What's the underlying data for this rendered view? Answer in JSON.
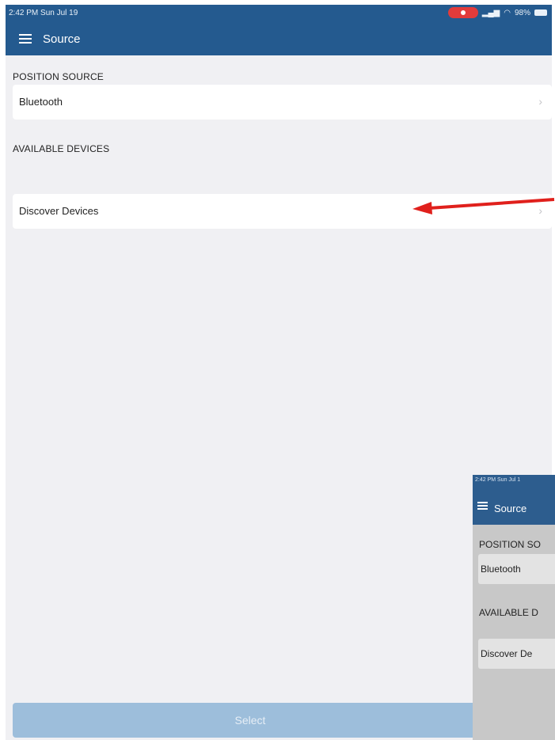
{
  "status_bar": {
    "time": "2:42 PM  Sun Jul 19",
    "battery": "98%"
  },
  "nav": {
    "title": "Source"
  },
  "position_source": {
    "header": "POSITION SOURCE",
    "value": "Bluetooth"
  },
  "available_devices": {
    "header": "AVAILABLE DEVICES",
    "discover_label": "Discover Devices"
  },
  "footer": {
    "select_label": "Select"
  },
  "thumbnail": {
    "time": "2:42 PM  Sun Jul 1",
    "title": "Source",
    "position_header": "POSITION SO",
    "position_value": "Bluetooth",
    "devices_header": "AVAILABLE D",
    "discover_label": "Discover De"
  },
  "colors": {
    "nav_background": "#245a8f",
    "select_button": "#9dbedb",
    "annotation_arrow": "#e0201c",
    "recording_indicator": "#e23b3b"
  },
  "icons": [
    "menu-icon",
    "chevron-right-icon",
    "annotation-arrow",
    "wifi-icon",
    "signal-icon",
    "battery-icon",
    "screen-recording-icon"
  ]
}
